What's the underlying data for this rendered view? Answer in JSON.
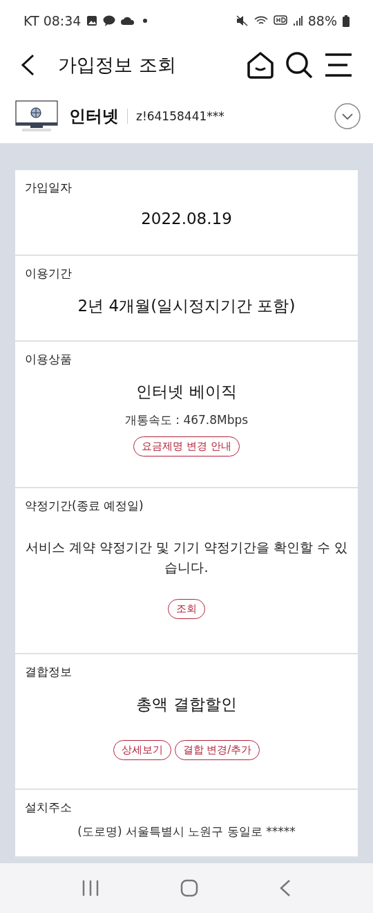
{
  "status_bar": {
    "carrier_time": "KT 08:34",
    "battery": "88%"
  },
  "header": {
    "title": "가입정보 조회"
  },
  "service": {
    "name": "인터넷",
    "account": "z!64158441***"
  },
  "sections": [
    {
      "label": "가입일자",
      "value": "2022.08.19"
    },
    {
      "label": "이용기간",
      "value": "2년 4개월(일시정지기간 포함)"
    },
    {
      "label": "이용상품",
      "value": "인터넷 베이직",
      "detail": "개통속도 : 467.8Mbps",
      "buttons": [
        "요금제명 변경 안내"
      ]
    },
    {
      "label": "약정기간(종료 예정일)",
      "description": "서비스 계약 약정기간 및 기기 약정기간을 확인할 수 있습니다.",
      "buttons": [
        "조회"
      ]
    },
    {
      "label": "결합정보",
      "value": "총액 결합할인",
      "buttons": [
        "상세보기",
        "결합 변경/추가"
      ]
    },
    {
      "label": "설치주소",
      "detail": "(도로명) 서울특별시 노원구 동일로 *****"
    }
  ]
}
